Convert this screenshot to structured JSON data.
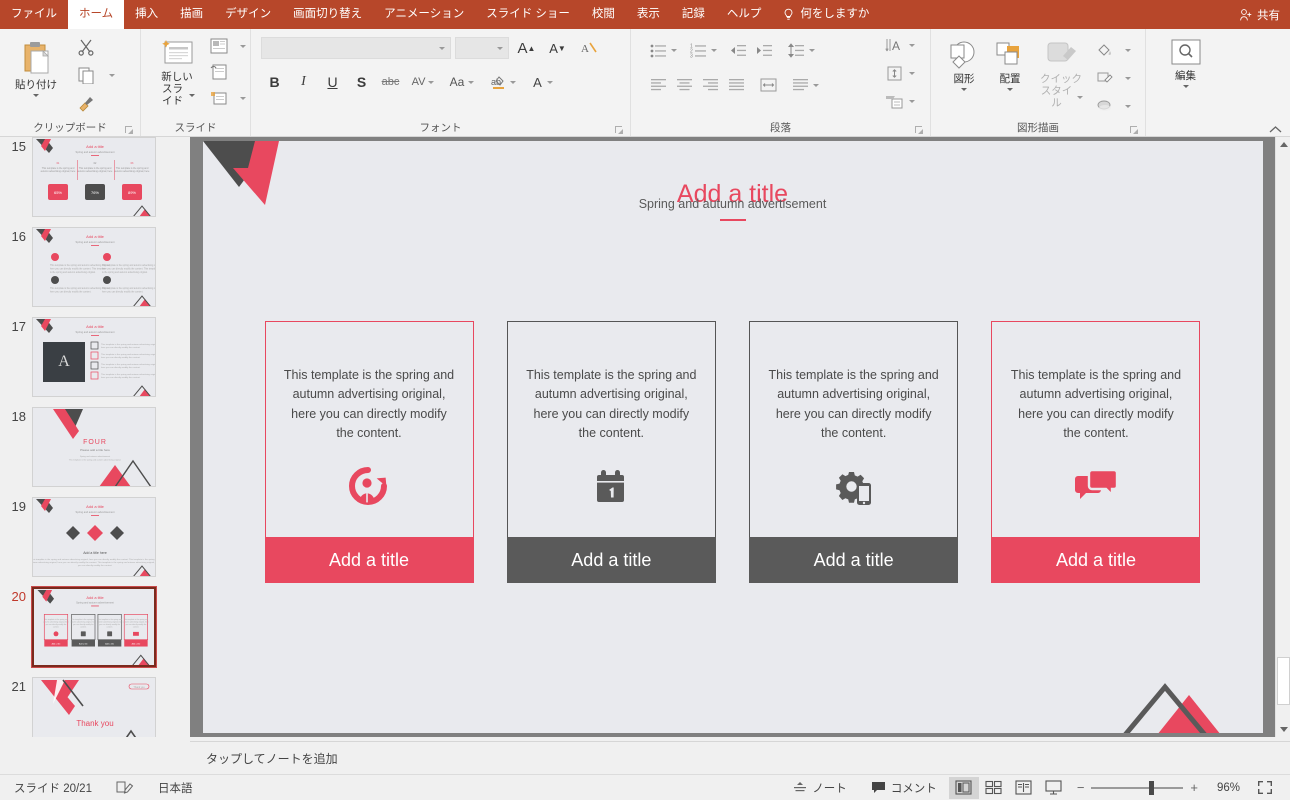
{
  "window": {
    "ribbon_tabs": [
      {
        "label": "ファイル",
        "active": false
      },
      {
        "label": "ホーム",
        "active": true
      },
      {
        "label": "挿入",
        "active": false
      },
      {
        "label": "描画",
        "active": false
      },
      {
        "label": "デザイン",
        "active": false
      },
      {
        "label": "画面切り替え",
        "active": false
      },
      {
        "label": "アニメーション",
        "active": false
      },
      {
        "label": "スライド ショー",
        "active": false
      },
      {
        "label": "校閲",
        "active": false
      },
      {
        "label": "表示",
        "active": false
      },
      {
        "label": "記録",
        "active": false
      },
      {
        "label": "ヘルプ",
        "active": false
      }
    ],
    "tell_me": "何をしますか",
    "share_label": "共有",
    "accent_color": "#b7472a"
  },
  "ribbon": {
    "groups": [
      {
        "name": "clipboard",
        "label": "クリップボード",
        "paste_label": "貼り付け"
      },
      {
        "name": "slides",
        "label": "スライド",
        "new_slide_label": "新しい\nスライド"
      },
      {
        "name": "font",
        "label": "フォント",
        "font_name_value": "",
        "font_size_value": ""
      },
      {
        "name": "paragraph",
        "label": "段落"
      },
      {
        "name": "drawing",
        "label": "図形描画",
        "shapes_label": "図形",
        "arrange_label": "配置",
        "quick_styles_label": "クイック\nスタイル"
      },
      {
        "name": "editing",
        "label": "編集",
        "edit_label": "編集"
      }
    ],
    "font_group": {
      "name_label": "フォント",
      "name_value": "",
      "size_value": "",
      "bold": "B",
      "italic": "I",
      "underline": "U",
      "shadow": "S",
      "strikethrough": "abc",
      "char_spacing": "AV",
      "change_case": "Aa",
      "text_highlight": "ab",
      "font_color": "A",
      "grow_font": "A",
      "shrink_font": "A"
    },
    "drawing_group": {
      "shapes_label": "図形",
      "arrange_label": "配置",
      "quick_styles_line1": "クイック",
      "quick_styles_line2": "スタイル"
    },
    "editing_group": {
      "edit_label": "編集"
    },
    "slides_group": {
      "new_slide_line1": "新しい",
      "new_slide_line2": "スライド"
    },
    "clipboard_group": {
      "paste_label": "貼り付け"
    }
  },
  "thumbnails": {
    "selected_index": 20,
    "items": [
      {
        "number": "15",
        "kind": "three-col-stats"
      },
      {
        "number": "16",
        "kind": "four-icon-grid"
      },
      {
        "number": "17",
        "kind": "photo-list"
      },
      {
        "number": "18",
        "kind": "section-four",
        "title": "FOUR",
        "subtitle": "Please add a title here"
      },
      {
        "number": "19",
        "kind": "three-diamond"
      },
      {
        "number": "20",
        "kind": "four-card",
        "selected": true
      },
      {
        "number": "21",
        "kind": "thankyou",
        "title": "Thank you"
      }
    ]
  },
  "slide": {
    "title": "Add a title",
    "subtitle": "Spring and autumn advertisement",
    "cards": [
      {
        "text": "This template is the spring and autumn advertising original, here you can directly modify the content.",
        "footer_label": "Add a title",
        "icon": "person-growth-icon",
        "color": "red",
        "hex": "#e8485f"
      },
      {
        "text": "This template is the spring and autumn advertising original, here you can directly modify the content.",
        "footer_label": "Add a title",
        "icon": "calendar-icon",
        "color": "gray",
        "hex": "#5a5a5a"
      },
      {
        "text": "This template is the spring and autumn advertising original, here you can directly modify the content.",
        "footer_label": "Add a title",
        "icon": "gear-mobile-icon",
        "color": "gray",
        "hex": "#5a5a5a"
      },
      {
        "text": "This template is the spring and autumn advertising original, here you can directly modify the content.",
        "footer_label": "Add a title",
        "icon": "chat-bubbles-icon",
        "color": "red",
        "hex": "#e8485f"
      }
    ]
  },
  "notes": {
    "placeholder": "タップしてノートを追加"
  },
  "status": {
    "slide_counter": "スライド 20/21",
    "language": "日本語",
    "notes_label": "ノート",
    "comments_label": "コメント",
    "zoom_percent": "96%",
    "views": [
      "normal",
      "slide-sorter",
      "reading",
      "slide-show"
    ],
    "active_view": "normal"
  }
}
